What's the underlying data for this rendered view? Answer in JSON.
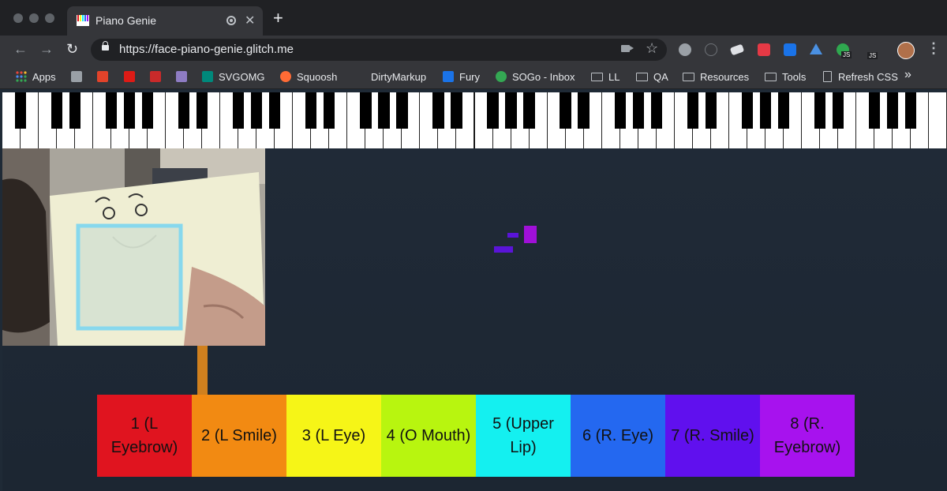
{
  "tab": {
    "title": "Piano Genie",
    "close": "✕",
    "new_tab": "+"
  },
  "nav": {
    "back": "←",
    "forward": "→",
    "reload": "↻"
  },
  "omnibox": {
    "url": "https://face-piano-genie.glitch.me",
    "star": "☆"
  },
  "extensions": {
    "badge_1": "JS",
    "badge_2": "JS",
    "menu": "⋮"
  },
  "bookmarks": {
    "apps": "Apps",
    "svgomg": "SVGOMG",
    "squoosh": "Squoosh",
    "dirtymarkup": "DirtyMarkup",
    "fury": "Fury",
    "sogo": "SOGo - Inbox",
    "ll": "LL",
    "qa": "QA",
    "resources": "Resources",
    "tools": "Tools",
    "refresh_css": "Refresh CSS",
    "more": "»"
  },
  "genie_keys": [
    {
      "label": "1 (L Eyebrow)",
      "color": "#e0141f"
    },
    {
      "label": "2 (L Smile)",
      "color": "#f28a12"
    },
    {
      "label": "3 (L Eye)",
      "color": "#f6f517"
    },
    {
      "label": "4 (O Mouth)",
      "color": "#b8f50f"
    },
    {
      "label": "5 (Upper Lip)",
      "color": "#14f0f0"
    },
    {
      "label": "6 (R. Eye)",
      "color": "#2468f0"
    },
    {
      "label": "7 (R. Smile)",
      "color": "#6010ee"
    },
    {
      "label": "8 (R. Eyebrow)",
      "color": "#a712ee"
    }
  ],
  "active_key_index": 1,
  "colors": {
    "stage": "#1f2a36",
    "active_stem": "#d0801e",
    "note_purple": "#a010d8",
    "note_indigo": "#5a14d8"
  }
}
